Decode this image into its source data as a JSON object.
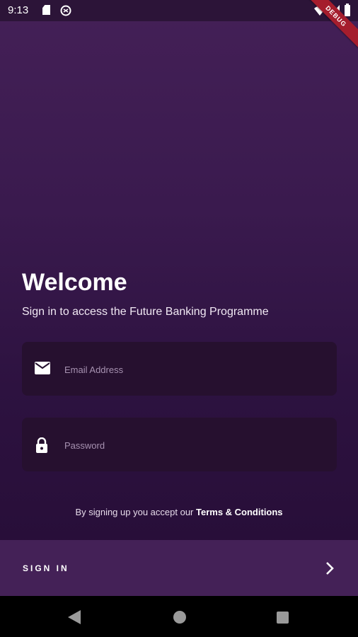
{
  "status_bar": {
    "time": "9:13",
    "icons": [
      "sd-card-icon",
      "vpn-icon",
      "wifi-icon",
      "signal-icon",
      "battery-icon"
    ]
  },
  "debug_banner": "DEBUG",
  "welcome": {
    "title": "Welcome",
    "subtitle": "Sign in to access the Future Banking Programme"
  },
  "form": {
    "email": {
      "placeholder": "Email Address",
      "value": "",
      "icon": "mail-icon"
    },
    "password": {
      "placeholder": "Password",
      "value": "",
      "icon": "lock-icon"
    }
  },
  "terms": {
    "prefix": "By signing up you accept our ",
    "link": "Terms & Conditions"
  },
  "sign_in": {
    "label": "SIGN IN",
    "icon": "chevron-right-icon"
  },
  "nav_bar": {
    "buttons": [
      "back",
      "home",
      "recents"
    ]
  },
  "colors": {
    "background_top": "#442057",
    "background_bottom": "#260d36",
    "field_background": "#26102f",
    "signin_bar": "#442157",
    "debug_ribbon": "#a51d2d"
  }
}
